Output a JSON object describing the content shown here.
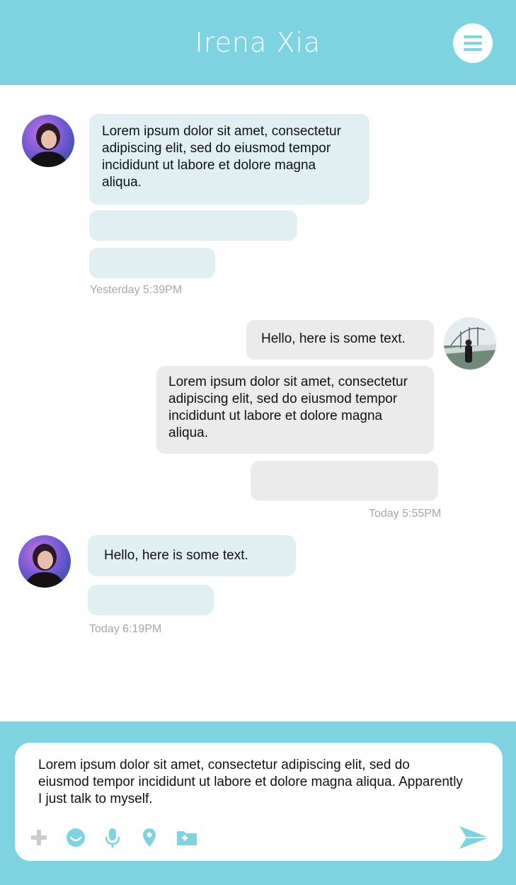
{
  "header": {
    "title": "Irena Xia",
    "menu_icon": "hamburger-menu-icon"
  },
  "colors": {
    "accent": "#7dd3df",
    "incoming_bubble": "#dfeff2",
    "outgoing_bubble": "#ebebeb",
    "timestamp": "#a6a6a6",
    "placeholder_icon": "#cccccc"
  },
  "conversation": {
    "group1": {
      "message1": "Lorem ipsum dolor sit amet, consectetur adipiscing elit, sed do eiusmod tempor incididunt ut labore et dolore magna aliqua.",
      "timestamp": "Yesterday 5:39PM"
    },
    "group2": {
      "message1": "Hello, here is some text.",
      "message2": "Lorem ipsum dolor sit amet, consectetur adipiscing elit, sed do eiusmod tempor incididunt ut labore et dolore magna aliqua.",
      "timestamp": "Today 5:55PM"
    },
    "group3": {
      "message1": "Hello, here is some text.",
      "timestamp": "Today 6:19PM"
    }
  },
  "composer": {
    "text": "Lorem ipsum dolor sit amet, consectetur adipiscing elit, sed do eiusmod tempor incididunt ut labore et dolore magna aliqua. Apparently I just talk to myself.",
    "tools": [
      "plus-icon",
      "emoji-icon",
      "microphone-icon",
      "location-pin-icon",
      "add-folder-icon"
    ],
    "send_icon": "send-icon"
  }
}
